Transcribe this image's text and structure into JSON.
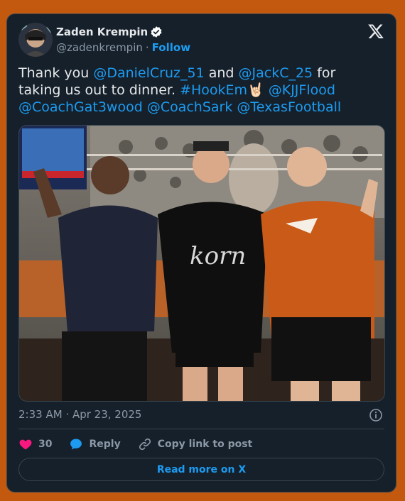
{
  "author": {
    "display_name": "Zaden Krempin",
    "handle": "@zadenkrempin",
    "separator": "·",
    "follow_label": "Follow",
    "verified_color": "#ffffff"
  },
  "tweet": {
    "parts": [
      {
        "type": "text",
        "value": "Thank you  "
      },
      {
        "type": "mention",
        "value": "@DanielCruz_51"
      },
      {
        "type": "text",
        "value": " and "
      },
      {
        "type": "mention",
        "value": "@JackC_25"
      },
      {
        "type": "text",
        "value": " for taking us out to dinner. "
      },
      {
        "type": "hashtag",
        "value": "#HookEm"
      },
      {
        "type": "emoji",
        "value": "🤘🏻"
      },
      {
        "type": "text",
        "value": " "
      },
      {
        "type": "mention",
        "value": "@KJJFlood"
      },
      {
        "type": "text",
        "value": " "
      },
      {
        "type": "mention",
        "value": "@CoachGat3wood"
      },
      {
        "type": "text",
        "value": " "
      },
      {
        "type": "mention",
        "value": "@CoachSark"
      },
      {
        "type": "text",
        "value": " "
      },
      {
        "type": "mention",
        "value": "@TexasFootball"
      }
    ]
  },
  "meta": {
    "timestamp": "2:33 AM · Apr 23, 2025"
  },
  "actions": {
    "like_count": "30",
    "reply_label": "Reply",
    "copy_label": "Copy link to post"
  },
  "footer": {
    "read_more_label": "Read more on X"
  },
  "colors": {
    "background": "#c2590f",
    "card": "#15202b",
    "accent": "#1d9bf0",
    "like": "#f91880",
    "muted": "#8b98a5"
  }
}
